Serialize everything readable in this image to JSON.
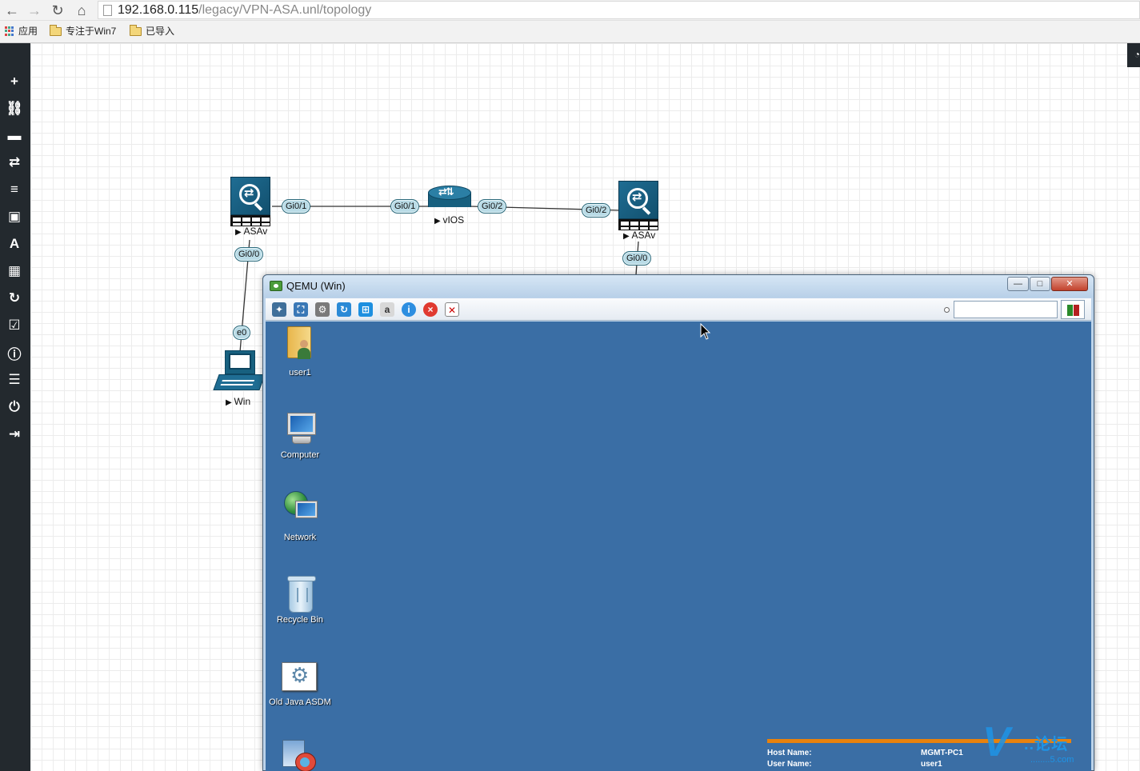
{
  "browser": {
    "url_host": "192.168.0.115",
    "url_path": "/legacy/VPN-ASA.unl/topology",
    "bookmarks": [
      {
        "label": "应用",
        "icon": "apps-grid-icon"
      },
      {
        "label": "专注于Win7",
        "icon": "folder-icon"
      },
      {
        "label": "已导入",
        "icon": "folder-icon"
      }
    ]
  },
  "sidebar": {
    "items": [
      {
        "name": "add-icon",
        "glyph": "+"
      },
      {
        "name": "link-icon",
        "glyph": "🔗"
      },
      {
        "name": "hdd-icon",
        "glyph": "▬"
      },
      {
        "name": "exchange-icon",
        "glyph": "⇄"
      },
      {
        "name": "list-align-icon",
        "glyph": "≡"
      },
      {
        "name": "image-icon",
        "glyph": "▣"
      },
      {
        "name": "text-icon",
        "glyph": "A"
      },
      {
        "name": "grid-icon",
        "glyph": "▦"
      },
      {
        "name": "refresh-icon",
        "glyph": "↻"
      },
      {
        "name": "checkbox-icon",
        "glyph": "☑"
      },
      {
        "name": "info-icon",
        "glyph": "ℹ"
      },
      {
        "name": "list-icon",
        "glyph": "☰"
      },
      {
        "name": "power-icon",
        "glyph": "⏻"
      },
      {
        "name": "logout-icon",
        "glyph": "⇥"
      }
    ]
  },
  "topology": {
    "nodes": {
      "asav_left": {
        "label": "ASAv"
      },
      "vios": {
        "label": "vIOS"
      },
      "asav_right": {
        "label": "ASAv"
      },
      "win": {
        "label": "Win"
      }
    },
    "ports": {
      "asav_left_gi01": "Gi0/1",
      "vios_gi01": "Gi0/1",
      "vios_gi02": "Gi0/2",
      "asav_right_gi02": "Gi0/2",
      "asav_left_gi00": "Gi0/0",
      "asav_right_gi00": "Gi0/0",
      "win_e0": "e0"
    }
  },
  "qemu_window": {
    "title": "QEMU (Win)",
    "buttons": {
      "minimize": "—",
      "maximize": "□",
      "close": "✕"
    },
    "desktop_icons": [
      {
        "label": "user1"
      },
      {
        "label": "Computer"
      },
      {
        "label": "Network"
      },
      {
        "label": "Recycle Bin"
      },
      {
        "label": "Old Java ASDM"
      }
    ],
    "bginfo": {
      "host_key": "Host Name:",
      "host_val": "MGMT-PC1",
      "user_key": "User Name:",
      "user_val": "user1"
    },
    "colors": {
      "desktop": "#3a6ea5",
      "bginfo_bar": "#e8820d"
    }
  },
  "watermark": {
    "logo_letter": "V",
    "title": "..论坛",
    "subtitle": "........5.com"
  },
  "colors": {
    "sidebar": "#23292e",
    "port_fill": "#b9dbe6",
    "device_blue": "#17607f"
  }
}
